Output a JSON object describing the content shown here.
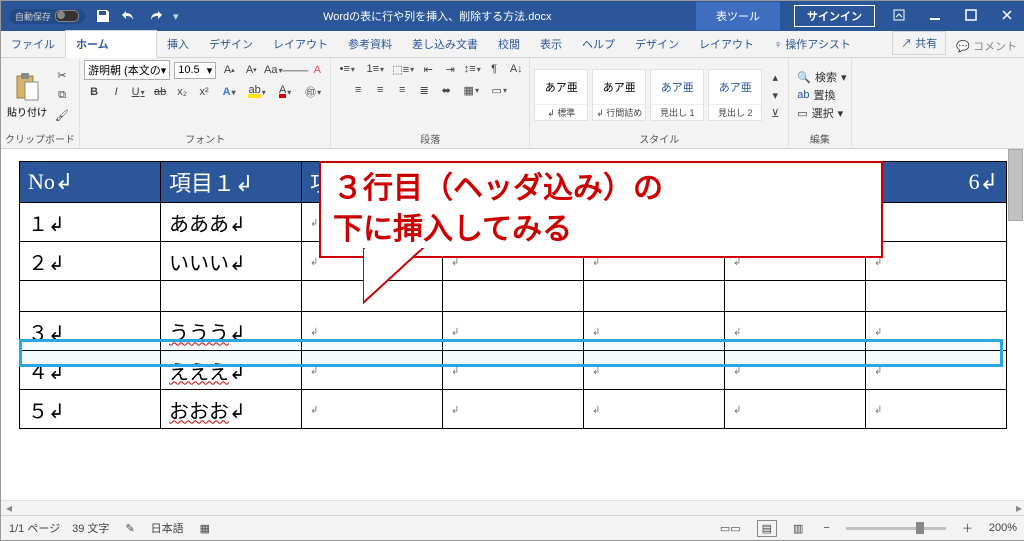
{
  "titlebar": {
    "autosave": "自動保存",
    "docname": "Wordの表に行や列を挿入、削除する方法.docx",
    "tabletools": "表ツール",
    "signin": "サインイン"
  },
  "tabs": {
    "file": "ファイル",
    "home": "ホーム",
    "insert": "挿入",
    "design": "デザイン",
    "layout": "レイアウト",
    "reference": "参考資料",
    "mail": "差し込み文書",
    "review": "校閲",
    "view": "表示",
    "help": "ヘルプ",
    "tdesign": "デザイン",
    "tlayout": "レイアウト",
    "search": "操作アシスト",
    "share": "共有",
    "comments": "コメント"
  },
  "ribbon": {
    "clipboard": {
      "label": "クリップボード",
      "paste": "貼り付け"
    },
    "font": {
      "label": "フォント",
      "name": "游明朝 (本文の",
      "size": "10.5"
    },
    "para": {
      "label": "段落"
    },
    "styles": {
      "label": "スタイル",
      "preview": "あア亜",
      "s1": "標準",
      "s2": "行間詰め",
      "s3": "見出し 1",
      "s4": "見出し 2"
    },
    "edit": {
      "label": "編集",
      "find": "検索",
      "replace": "置換",
      "select": "選択"
    }
  },
  "callout": {
    "line1": "３行目（ヘッダ込み）の",
    "line2": "下に挿入してみる"
  },
  "table": {
    "head": [
      "No",
      "項目１",
      "項",
      "6"
    ],
    "rows": [
      [
        "１",
        "あああ"
      ],
      [
        "２",
        "いいい"
      ],
      [
        "３",
        "ううう"
      ],
      [
        "４",
        "えええ"
      ],
      [
        "５",
        "おおお"
      ]
    ]
  },
  "status": {
    "page": "1/1 ページ",
    "words": "39 文字",
    "lang": "日本語",
    "zoom": "200%"
  }
}
